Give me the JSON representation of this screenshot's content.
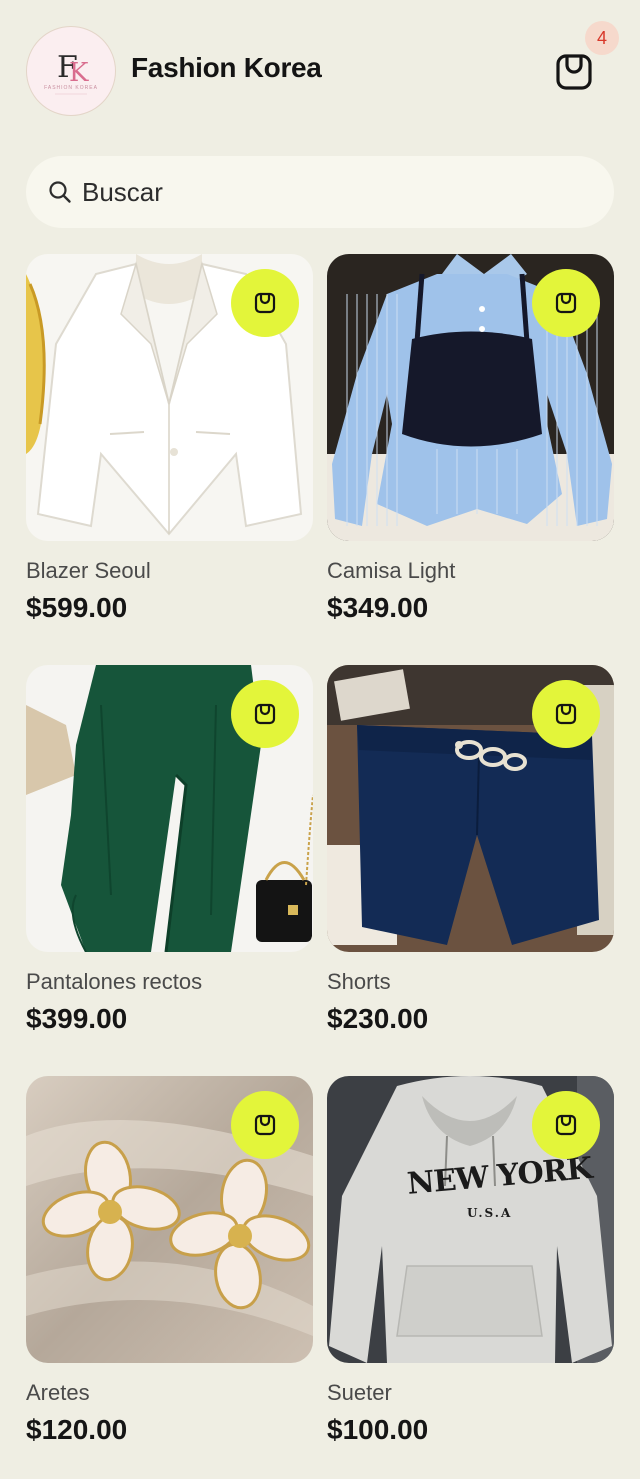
{
  "header": {
    "logo_text": "FASHION KOREA",
    "logo_monogram": "FK",
    "title": "Fashion Korea",
    "cart_count": "4"
  },
  "search": {
    "placeholder": "Buscar"
  },
  "theme": {
    "background": "#efeee3",
    "accent": "#e3f53a",
    "badge_bg": "#f6d9cc",
    "badge_text": "#d8382a"
  },
  "icons": {
    "cart": "shopping-bag-icon",
    "search": "search-icon",
    "add": "shopping-bag-icon"
  },
  "products": [
    {
      "name": "Blazer Seoul",
      "price": "$599.00"
    },
    {
      "name": "Camisa Light",
      "price": "$349.00"
    },
    {
      "name": "Pantalones rectos",
      "price": "$399.00"
    },
    {
      "name": "Shorts",
      "price": "$230.00"
    },
    {
      "name": "Aretes",
      "price": "$120.00"
    },
    {
      "name": "Sueter",
      "price": "$100.00"
    }
  ]
}
